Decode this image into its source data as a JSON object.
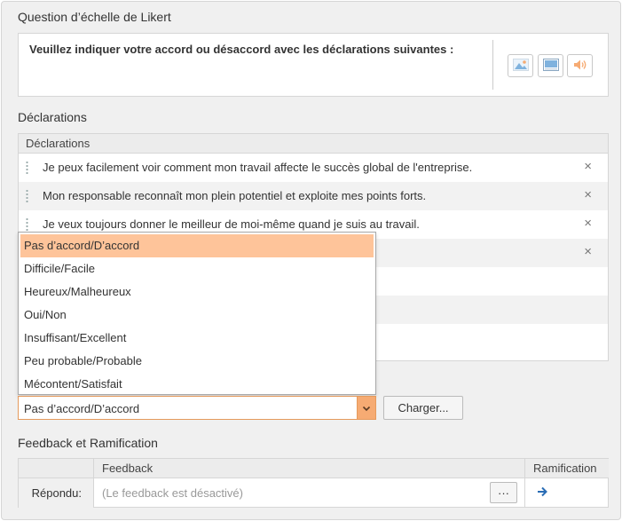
{
  "question_section": {
    "title": "Question d’échelle de Likert",
    "prompt": "Veuillez indiquer votre accord ou désaccord avec les déclarations suivantes :",
    "media_icons": [
      "image-icon",
      "video-icon",
      "audio-icon"
    ]
  },
  "statements_section": {
    "title": "Déclarations",
    "column_header": "Déclarations",
    "rows": [
      {
        "text": "Je peux facilement voir comment mon travail affecte le succès global de l'entreprise.",
        "delete": "×"
      },
      {
        "text": "Mon responsable reconnaît mon plein potentiel et exploite mes points forts.",
        "delete": "×"
      },
      {
        "text": "Je veux toujours donner le meilleur de moi-même quand je suis au travail.",
        "delete": "×"
      },
      {
        "text": "",
        "delete": "×"
      }
    ]
  },
  "scale_dropdown": {
    "options": [
      "Pas d’accord/D’accord",
      "Difficile/Facile",
      "Heureux/Malheureux",
      "Oui/Non",
      "Insuffisant/Excellent",
      "Peu probable/Probable",
      "Mécontent/Satisfait"
    ],
    "selected": "Pas d’accord/D’accord",
    "load_button": "Charger..."
  },
  "feedback_section": {
    "title": "Feedback et Ramification",
    "headers": {
      "feedback": "Feedback",
      "branching": "Ramification"
    },
    "row_label": "Répondu:",
    "feedback_placeholder": "(Le feedback est désactivé)",
    "more_button": "···"
  },
  "colors": {
    "accent": "#f6ab73",
    "selected_option": "#fec49a",
    "arrow": "#2a6db5"
  }
}
